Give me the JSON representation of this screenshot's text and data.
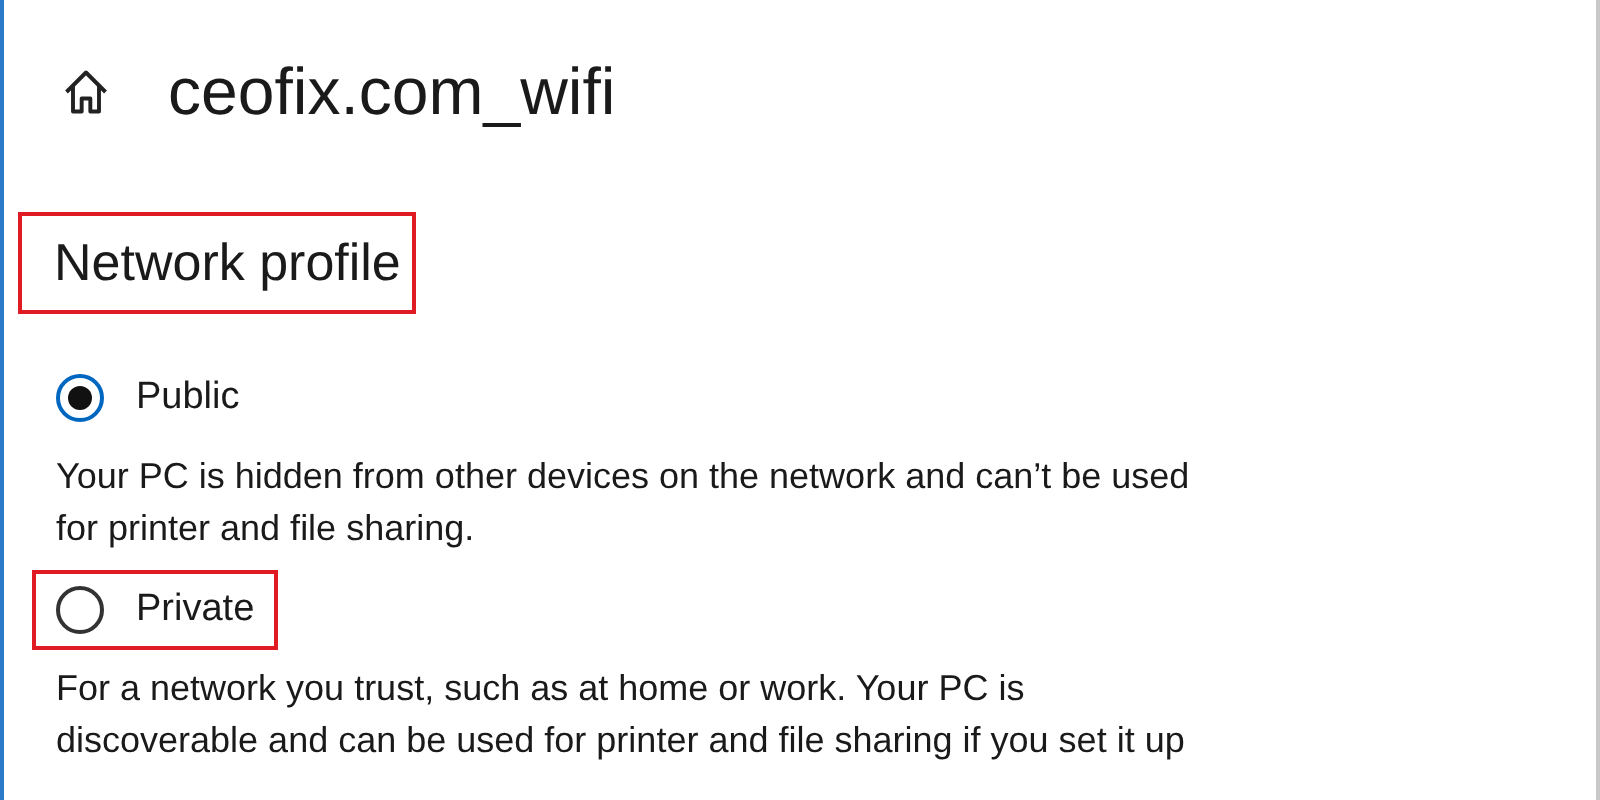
{
  "page": {
    "title": "ceofix.com_wifi"
  },
  "section": {
    "heading": "Network profile",
    "highlighted": true
  },
  "options": [
    {
      "label": "Public",
      "selected": true,
      "highlighted": false,
      "description": [
        "Your PC is hidden from other devices on the network and can’t be used",
        "for printer and file sharing."
      ]
    },
    {
      "label": "Private",
      "selected": false,
      "highlighted": true,
      "description": [
        "For a network you trust, such as at home or work. Your PC is",
        "discoverable and can be used for printer and file sharing if you set it up"
      ]
    }
  ]
}
